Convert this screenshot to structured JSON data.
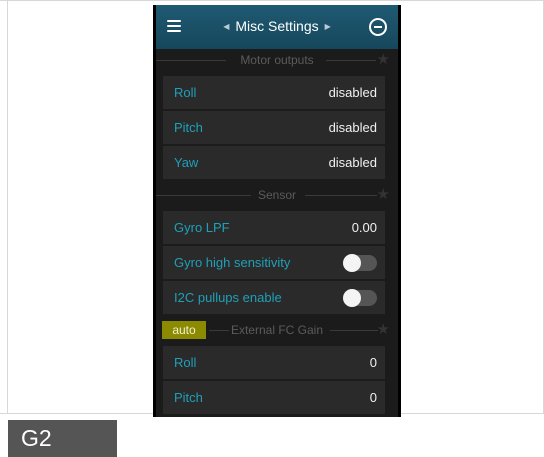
{
  "header": {
    "title": "Misc Settings",
    "prev_icon": "triangle-left",
    "next_icon": "triangle-right",
    "menu_icon": "hamburger",
    "back_icon": "circle-minus"
  },
  "sections": {
    "motor_outputs": {
      "title": "Motor outputs",
      "rows": [
        {
          "label": "Roll",
          "value": "disabled"
        },
        {
          "label": "Pitch",
          "value": "disabled"
        },
        {
          "label": "Yaw",
          "value": "disabled"
        }
      ]
    },
    "sensor": {
      "title": "Sensor",
      "rows": [
        {
          "label": "Gyro LPF",
          "value": "0.00"
        },
        {
          "label": "Gyro high sensitivity",
          "value": "off"
        },
        {
          "label": "I2C pullups enable",
          "value": "off"
        }
      ]
    },
    "external_fc_gain": {
      "title": "External FC Gain",
      "chip": "auto",
      "rows": [
        {
          "label": "Roll",
          "value": "0"
        },
        {
          "label": "Pitch",
          "value": "0"
        }
      ]
    }
  },
  "footer": {
    "badge": "G2"
  },
  "colors": {
    "topbar": "#1f5a73",
    "accent_text": "#1fa0b8",
    "auto_chip": "#8b8a00",
    "row_bg": "#2a2a2a",
    "screen_bg": "#1b1b1b"
  }
}
